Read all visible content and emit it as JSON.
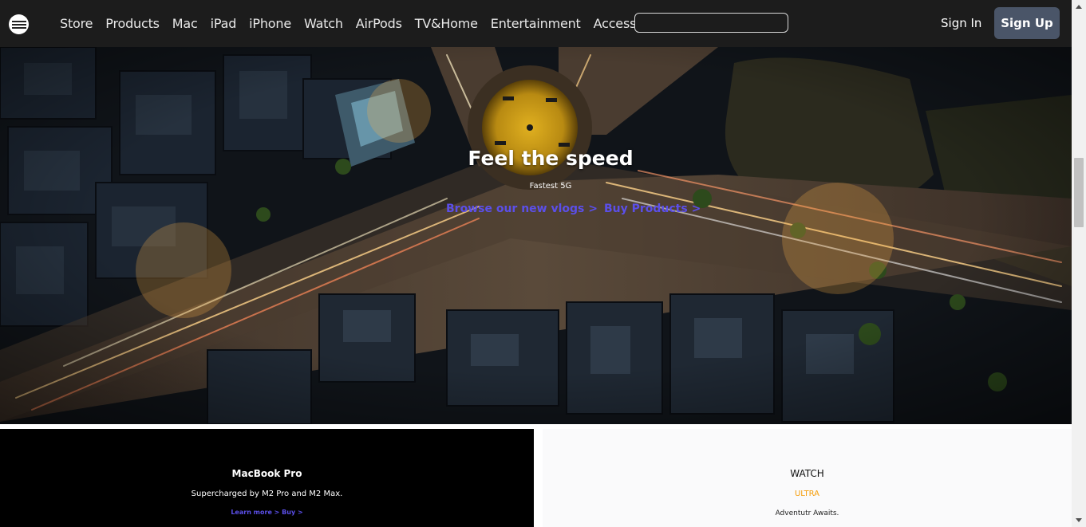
{
  "nav": {
    "logo_icon": "brand-logo-icon",
    "links": [
      "Store",
      "Products",
      "Mac",
      "iPad",
      "iPhone",
      "Watch",
      "AirPods",
      "TV&Home",
      "Entertainment",
      "Accessories"
    ],
    "search": {
      "value": "",
      "placeholder": ""
    },
    "sign_in": "Sign In",
    "sign_up": "Sign Up"
  },
  "hero": {
    "title": "Feel the speed",
    "subtitle": "Fastest 5G",
    "link_vlogs": "Browse our new vlogs >",
    "link_buy": "Buy Products >"
  },
  "macbook": {
    "title": "MacBook Pro",
    "subtitle": "Supercharged by M2 Pro and M2 Max.",
    "learn_more": "Learn more >",
    "buy": "Buy >"
  },
  "watch": {
    "title": "WATCH",
    "subtitle": "ULTRA",
    "description": "Adventutr Awaits."
  },
  "colors": {
    "nav_bg": "#1c1c1c",
    "signup_bg": "#4a5568",
    "link_accent": "#5b4fe9",
    "ultra_accent": "#f59e0b"
  }
}
